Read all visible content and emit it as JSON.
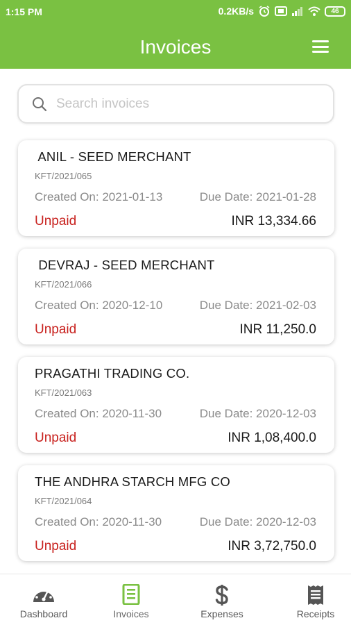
{
  "status_bar": {
    "time": "1:15 PM",
    "speed": "0.2KB/s",
    "battery": "46",
    "icons": [
      "alarm-icon",
      "screen-icon",
      "signal-icon",
      "wifi-icon",
      "battery-icon"
    ]
  },
  "header": {
    "title": "Invoices",
    "menu_icon": "hamburger-menu-icon",
    "color": "#7ac142"
  },
  "search": {
    "placeholder": "Search invoices",
    "value": ""
  },
  "invoices": [
    {
      "name": " ANIL - SEED MERCHANT",
      "number": "KFT/2021/065",
      "created": "Created On: 2021-01-13",
      "due": "Due Date: 2021-01-28",
      "status": "Unpaid",
      "amount": "INR 13,334.66"
    },
    {
      "name": " DEVRAJ - SEED MERCHANT",
      "number": "KFT/2021/066",
      "created": "Created On: 2020-12-10",
      "due": "Due Date: 2021-02-03",
      "status": "Unpaid",
      "amount": "INR 11,250.0"
    },
    {
      "name": "PRAGATHI TRADING CO.",
      "number": "KFT/2021/063",
      "created": "Created On: 2020-11-30",
      "due": "Due Date: 2020-12-03",
      "status": "Unpaid",
      "amount": "INR 1,08,400.0"
    },
    {
      "name": "THE ANDHRA STARCH MFG CO",
      "number": "KFT/2021/064",
      "created": "Created On: 2020-11-30",
      "due": "Due Date: 2020-12-03",
      "status": "Unpaid",
      "amount": "INR 3,72,750.0"
    }
  ],
  "status_color": "#c8211e",
  "bottom_nav": [
    {
      "label": "Dashboard",
      "icon": "gauge-icon",
      "active": false
    },
    {
      "label": "Invoices",
      "icon": "document-icon",
      "active": true
    },
    {
      "label": "Expenses",
      "icon": "dollar-icon",
      "active": false
    },
    {
      "label": "Receipts",
      "icon": "receipt-icon",
      "active": false
    }
  ]
}
